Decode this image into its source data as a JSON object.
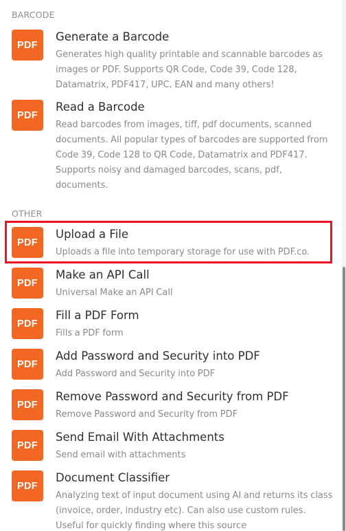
{
  "sections": {
    "barcode": "BARCODE",
    "other": "OTHER"
  },
  "badge_label": "PDF",
  "items": {
    "generate_barcode": {
      "title": "Generate a Barcode",
      "desc": "Generates high quality printable and scannable barcodes as images or PDF. Supports QR Code, Code 39, Code 128, Datamatrix, PDF417, UPC, EAN and many others!"
    },
    "read_barcode": {
      "title": "Read a Barcode",
      "desc": "Read barcodes from images, tiff, pdf documents, scanned documents. All popular types of barcodes are supported from Code 39, Code 128 to QR Code, Datamatrix and PDF417. Supports noisy and damaged barcodes, scans, pdf, documents."
    },
    "upload_file": {
      "title": "Upload a File",
      "desc": "Uploads a file into temporary storage for use with PDF.co."
    },
    "api_call": {
      "title": "Make an API Call",
      "desc": "Universal Make an API Call"
    },
    "fill_form": {
      "title": "Fill a PDF Form",
      "desc": "Fills a PDF form"
    },
    "add_password": {
      "title": "Add Password and Security into PDF",
      "desc": "Add Password and Security into PDF"
    },
    "remove_password": {
      "title": "Remove Password and Security from PDF",
      "desc": "Remove Password and Security from PDF"
    },
    "send_email": {
      "title": "Send Email With Attachments",
      "desc": "Send email with attachments"
    },
    "classifier": {
      "title": "Document Classifier",
      "desc": "Analyzing text of input document using AI and returns its class (invoice, order, industry etc). Can also use custom rules. Useful for quickly finding where this source"
    }
  },
  "colors": {
    "badge": "#f26722",
    "highlight": "#e8141f"
  }
}
